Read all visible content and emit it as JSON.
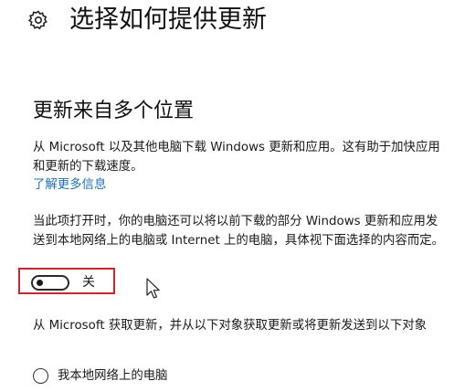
{
  "page": {
    "title": "选择如何提供更新"
  },
  "section": {
    "heading": "更新来自多个位置",
    "description": "从 Microsoft 以及其他电脑下载 Windows 更新和应用。这有助于加快应用和更新的下载速度。",
    "learn_more_link": "了解更多信息",
    "sharing_note": "当此项打开时，你的电脑还可以将以前下载的部分 Windows 更新和应用发送到本地网络上的电脑或 Internet 上的电脑，具体视下面选择的内容而定。"
  },
  "toggle": {
    "state_label": "关",
    "checked": false
  },
  "sources": {
    "description": "从 Microsoft 获取更新，并从以下对象获取更新或将更新发送到以下对象",
    "options": [
      {
        "label": "我本地网络上的电脑",
        "selected": false
      }
    ]
  },
  "colors": {
    "link": "#1d6fb5",
    "highlight_border": "#c6262e",
    "text": "#1a1a1a"
  },
  "icons": {
    "settings": "gear-icon",
    "pointer": "mouse-cursor-icon"
  }
}
